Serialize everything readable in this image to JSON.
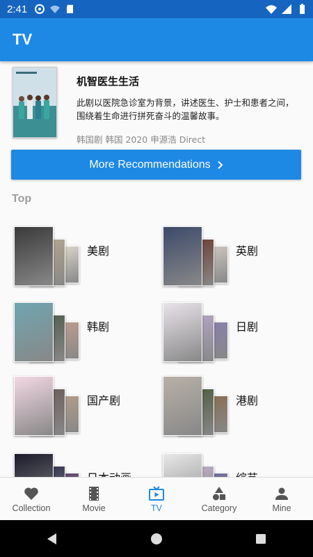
{
  "status": {
    "time": "2:41",
    "left_icons": [
      "vpn-key-icon",
      "wifi-question-icon",
      "sd-card-icon"
    ],
    "right_icons": [
      "wifi-icon",
      "signal-icon",
      "battery-icon"
    ]
  },
  "appbar": {
    "title": "TV"
  },
  "feature": {
    "title": "机智医生生活",
    "description": "此剧以医院急诊室为背景，讲述医生、护士和患者之间，围绕着生命进行拼死奋斗的温馨故事。",
    "meta": "韩国剧 韩国 2020 申源浩 Direct"
  },
  "more_button": {
    "label": "More Recommendations"
  },
  "section": {
    "title": "Top"
  },
  "categories": [
    {
      "label": "美剧",
      "colors": [
        "#3a3a3a",
        "#b8a890",
        "#e8e2d6"
      ]
    },
    {
      "label": "英剧",
      "colors": [
        "#3c4a6a",
        "#6a3a2e",
        "#d8d0c8"
      ]
    },
    {
      "label": "韩剧",
      "colors": [
        "#6fa5b0",
        "#4b5a4a",
        "#c6a090"
      ]
    },
    {
      "label": "日剧",
      "colors": [
        "#e9e3ea",
        "#b7a9c8",
        "#8a7db0"
      ]
    },
    {
      "label": "国产剧",
      "colors": [
        "#f3d8e4",
        "#6a5a58",
        "#b8a08a"
      ]
    },
    {
      "label": "港剧",
      "colors": [
        "#b8b0a8",
        "#4a5a3a",
        "#8a6a4a"
      ]
    },
    {
      "label": "日本动画",
      "colors": [
        "#1a1a2a",
        "#2a2a4a",
        "#5a3a6a"
      ]
    },
    {
      "label": "综艺",
      "colors": [
        "#e8e8e8",
        "#c0b0c8",
        "#6a6aa0"
      ]
    }
  ],
  "bottom_nav": {
    "items": [
      {
        "label": "Collection",
        "icon": "heart-icon"
      },
      {
        "label": "Movie",
        "icon": "film-icon"
      },
      {
        "label": "TV",
        "icon": "tv-icon"
      },
      {
        "label": "Category",
        "icon": "shapes-icon"
      },
      {
        "label": "Mine",
        "icon": "person-icon"
      }
    ],
    "active": "TV"
  },
  "colors": {
    "primary": "#1e88e5",
    "status_bar": "#1565c0"
  }
}
